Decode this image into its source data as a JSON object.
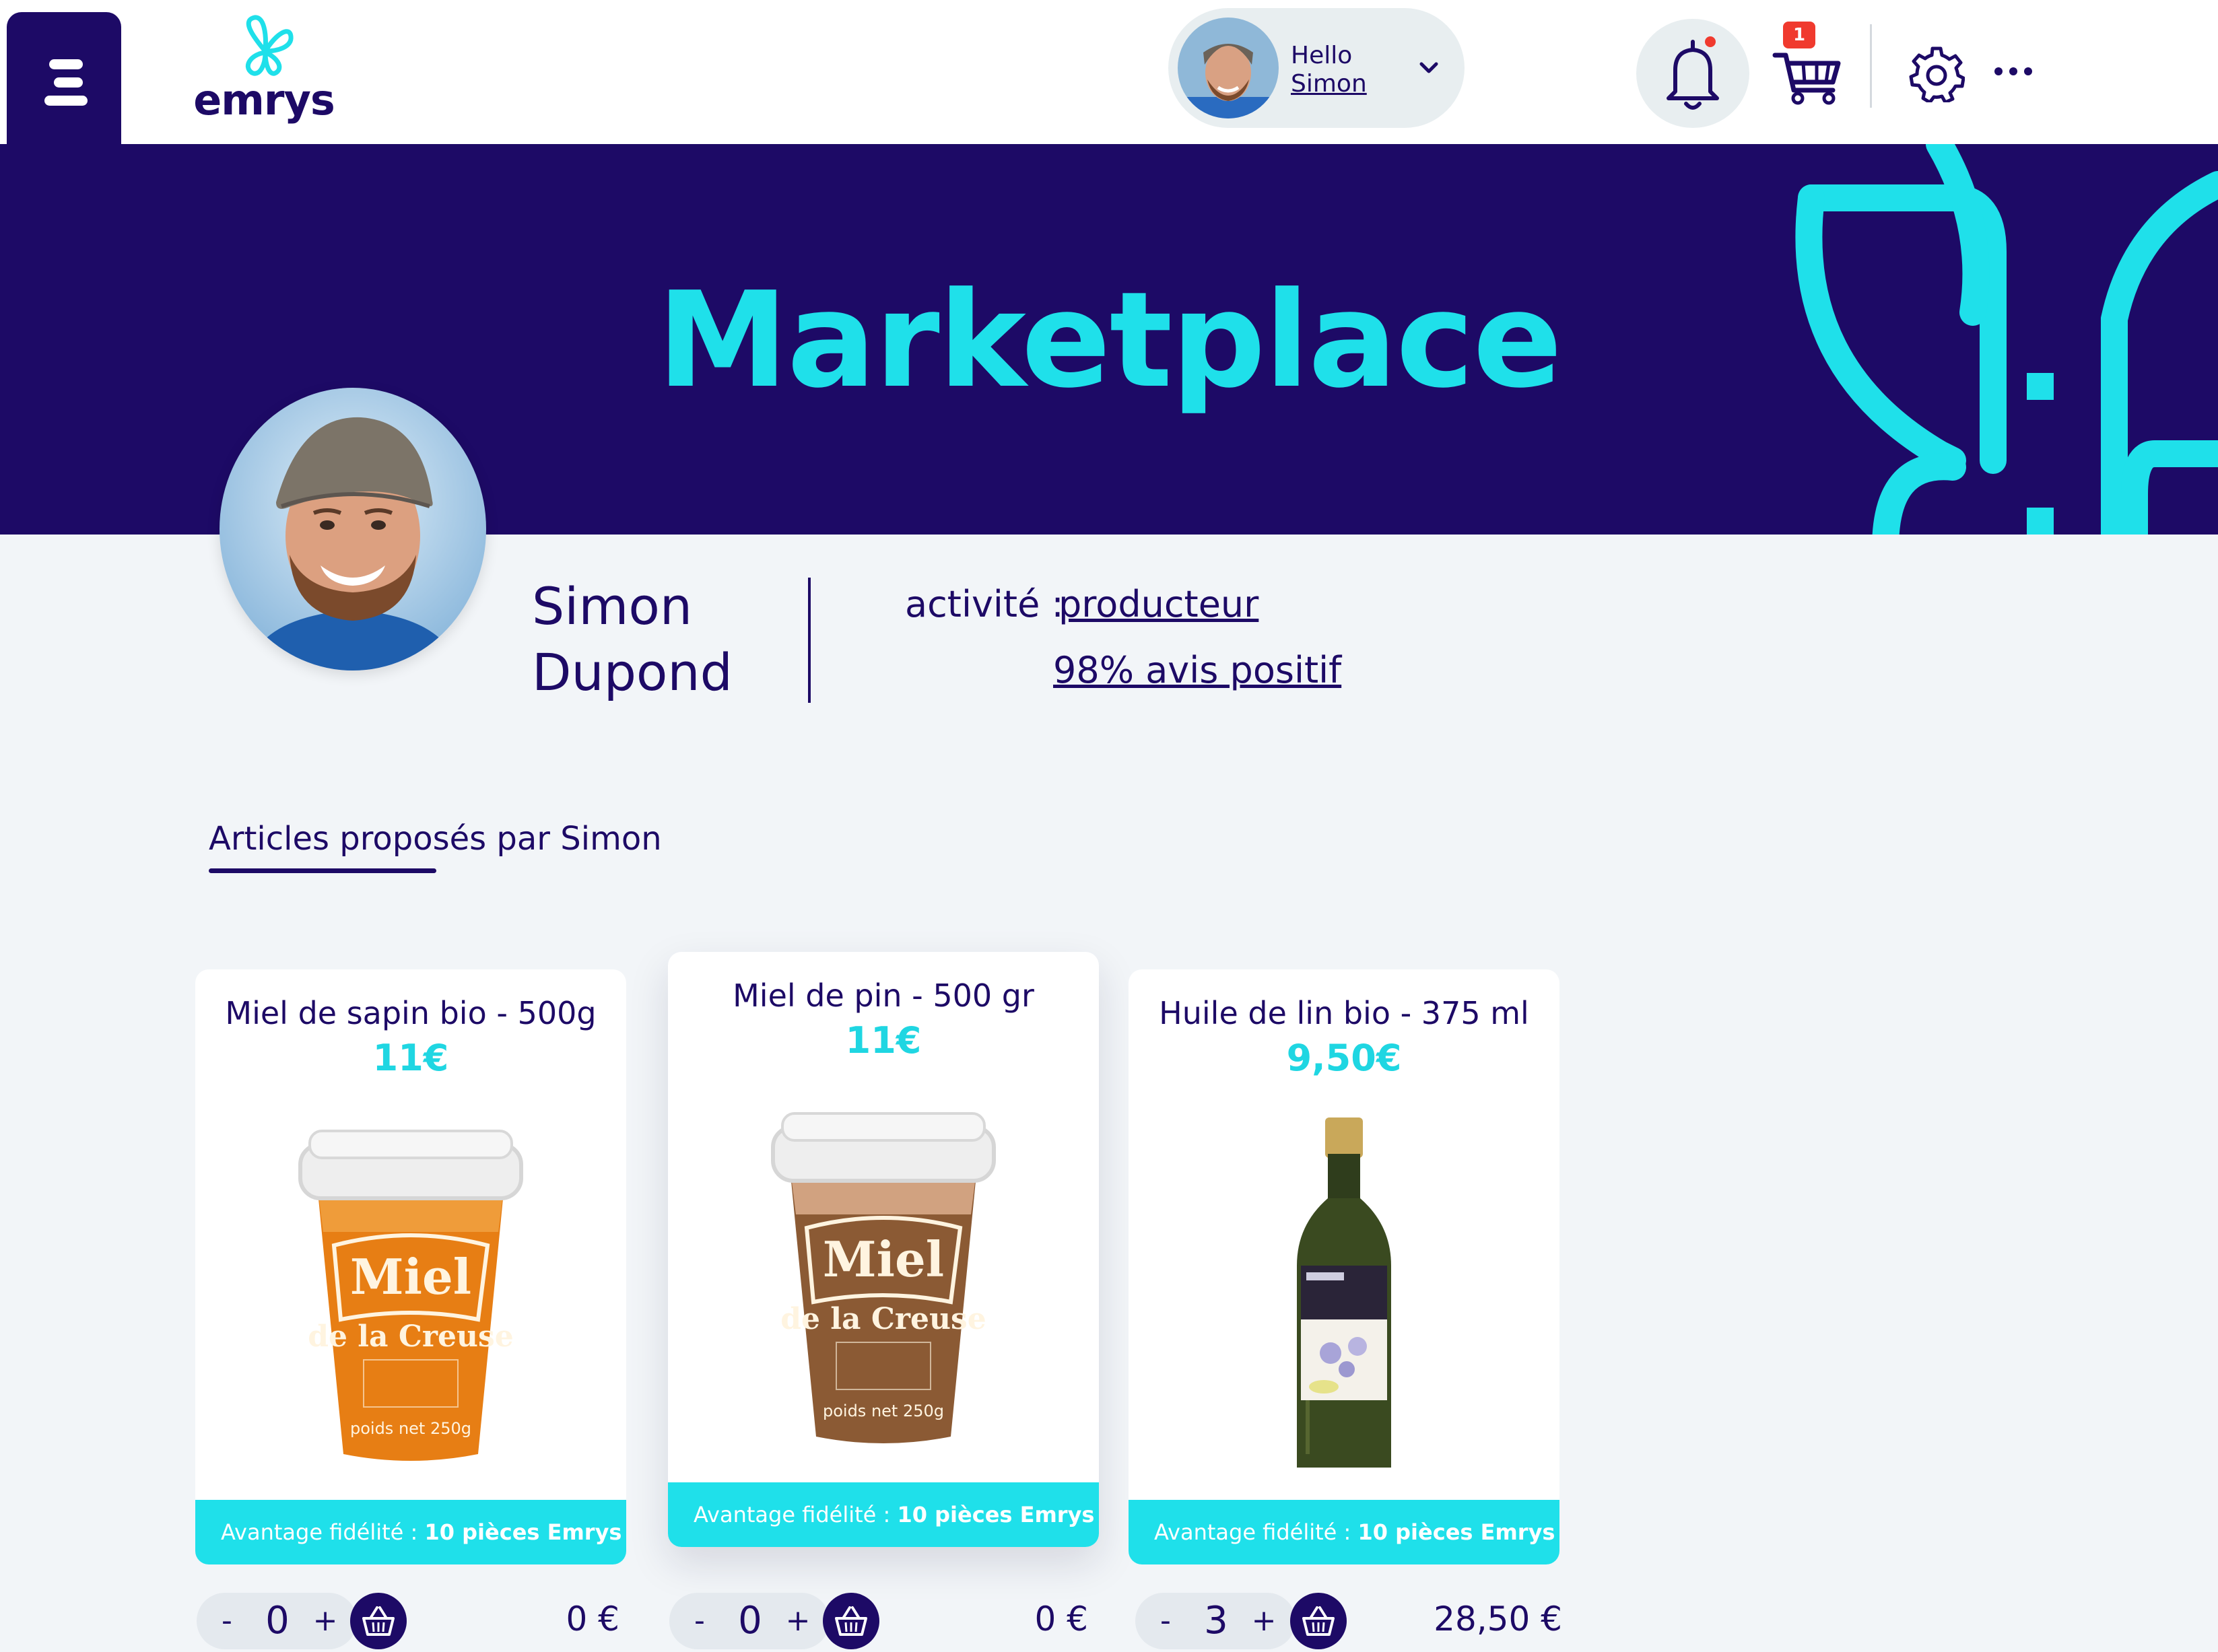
{
  "header": {
    "logo_text": "emrys",
    "greeting": "Hello",
    "user_name": "Simon",
    "cart_count": "1"
  },
  "banner": {
    "title": "Marketplace"
  },
  "profile": {
    "first_name": "Simon",
    "last_name": "Dupond",
    "activity_label": "activité :",
    "activity_value": "producteur",
    "rating": "98% avis positif"
  },
  "section": {
    "tab_label": "Articles proposés par Simon"
  },
  "products": [
    {
      "title": "Miel de sapin bio - 500g",
      "price": "11€",
      "loyalty_prefix": "Avantage fidélité : ",
      "loyalty_value": "10 pièces Emrys",
      "quantity": "0",
      "total": "0 €",
      "minus": "-",
      "plus": "+"
    },
    {
      "title": "Miel de pin - 500 gr",
      "price": "11€",
      "loyalty_prefix": "Avantage fidélité : ",
      "loyalty_value": "10 pièces Emrys",
      "quantity": "0",
      "total": "0 €",
      "minus": "-",
      "plus": "+"
    },
    {
      "title": "Huile de lin bio - 375 ml",
      "price": "9,50€",
      "loyalty_prefix": "Avantage fidélité : ",
      "loyalty_value": "10 pièces Emrys",
      "quantity": "3",
      "total": "28,50 €",
      "minus": "-",
      "plus": "+"
    }
  ],
  "colors": {
    "primary": "#1d0a66",
    "accent": "#1fe0ea",
    "background": "#f2f5f8",
    "badge": "#f03a2e"
  }
}
